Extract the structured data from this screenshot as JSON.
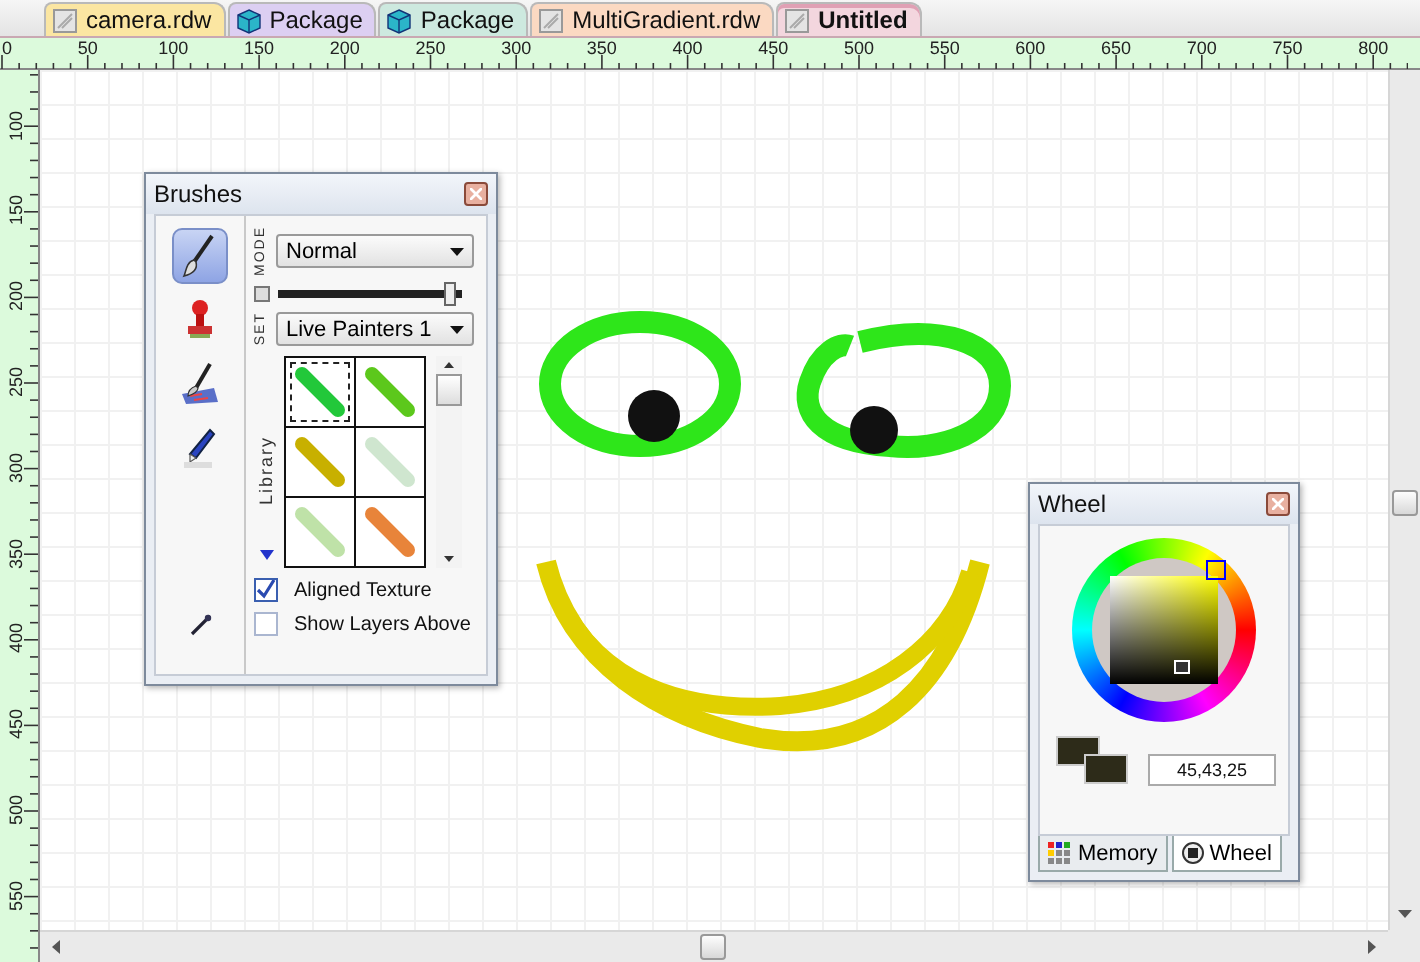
{
  "tabs": [
    {
      "label": "camera.rdw",
      "kind": "document",
      "color": "#fbe6a2",
      "selected": false
    },
    {
      "label": "Package",
      "kind": "package",
      "color": "#dccff2",
      "selected": false
    },
    {
      "label": "Package",
      "kind": "package",
      "color": "#cde9df",
      "selected": false
    },
    {
      "label": "MultiGradient.rdw",
      "kind": "document",
      "color": "#fbd9c2",
      "selected": false
    },
    {
      "label": "Untitled",
      "kind": "document",
      "color": "#f3d6de",
      "selected": true
    }
  ],
  "rulers": {
    "horizontal": [
      "0",
      "50",
      "100",
      "150",
      "200",
      "250",
      "300",
      "350",
      "400",
      "450",
      "500",
      "550",
      "600",
      "650",
      "700",
      "750",
      "800"
    ],
    "vertical": [
      "100",
      "150",
      "200",
      "250",
      "300",
      "350",
      "400",
      "450",
      "500",
      "550"
    ]
  },
  "brushes": {
    "title": "Brushes",
    "tools": [
      {
        "kind": "brush",
        "selected": true
      },
      {
        "kind": "stamp",
        "selected": false
      },
      {
        "kind": "palette",
        "selected": false
      },
      {
        "kind": "marker",
        "selected": false
      }
    ],
    "mode_label": "MODE",
    "mode": "Normal",
    "slider": {
      "level": 0.97
    },
    "set_label": "SET",
    "set": "Live Painters 1",
    "library_label": "Library",
    "swatches": [
      {
        "color": "#22c83a",
        "selected": true
      },
      {
        "color": "#5cc81c",
        "selected": false
      },
      {
        "color": "#c8b000",
        "selected": false
      },
      {
        "color": "#cfe6cf",
        "selected": false
      },
      {
        "color": "#bfe2a8",
        "selected": false
      },
      {
        "color": "#e8843a",
        "selected": false
      }
    ],
    "checkboxes": [
      {
        "label": "Aligned Texture",
        "checked": true
      },
      {
        "label": "Show Layers Above",
        "checked": false
      }
    ]
  },
  "wheel": {
    "title": "Wheel",
    "value": "45,43,25",
    "tabs": [
      {
        "label": "Memory",
        "kind": "memory",
        "selected": false
      },
      {
        "label": "Wheel",
        "kind": "wheel",
        "selected": true
      }
    ]
  }
}
